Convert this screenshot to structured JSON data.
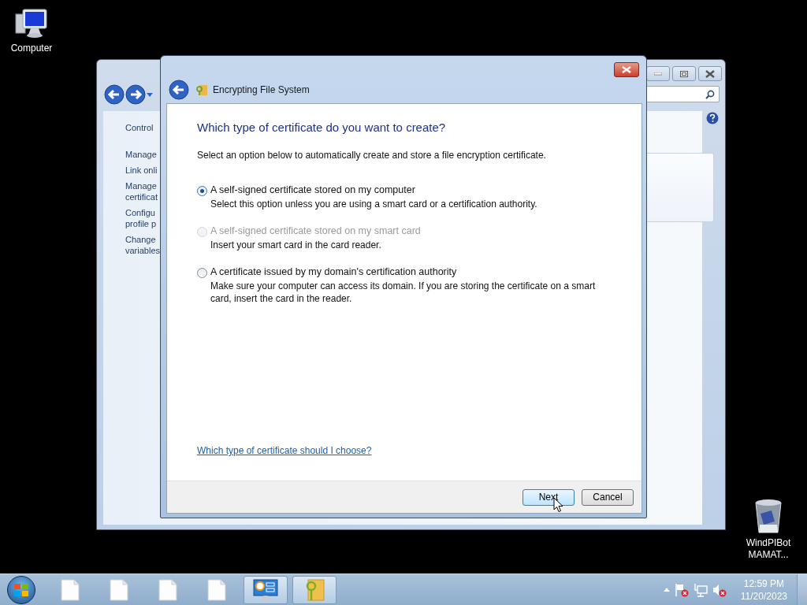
{
  "desktop_icons": [
    {
      "kind": "computer",
      "lines": [
        "Computer"
      ]
    },
    {
      "kind": "recycle-bin",
      "lines": [
        "WindPIBot",
        "MAMAT..."
      ]
    }
  ],
  "back_window": {
    "nav_items": [
      {
        "lines": [
          "Control"
        ]
      },
      {
        "lines": [
          "Manage"
        ]
      },
      {
        "lines": [
          "Link onli"
        ]
      },
      {
        "lines": [
          "Manage",
          "certificat"
        ]
      },
      {
        "lines": [
          "Configu",
          "profile p"
        ]
      },
      {
        "lines": [
          "Change",
          "variables"
        ]
      }
    ]
  },
  "dialog": {
    "title": "Encrypting File System",
    "heading": "Which type of certificate do you want to create?",
    "intro": "Select an option below to automatically create and store a file encryption certificate.",
    "options": [
      {
        "label": "A self-signed certificate stored on my computer",
        "description": "Select this option unless you are using a smart card or a certification authority.",
        "selected": true,
        "disabled": false
      },
      {
        "label": "A self-signed certificate stored on my smart card",
        "description": "Insert your smart card in the card reader.",
        "selected": false,
        "disabled": true
      },
      {
        "label": "A certificate issued by my domain's certification authority",
        "description": "Make sure your computer can access its domain. If you are storing the certificate on a smart card, insert the card in the reader.",
        "selected": false,
        "disabled": false
      }
    ],
    "help_link": "Which type of certificate should I choose?",
    "buttons": [
      {
        "label": "Next",
        "default": true
      },
      {
        "label": "Cancel",
        "default": false
      }
    ]
  },
  "taskbar": {
    "items": [
      {
        "kind": "document",
        "active": false
      },
      {
        "kind": "document",
        "active": false
      },
      {
        "kind": "document",
        "active": false
      },
      {
        "kind": "document",
        "active": false
      },
      {
        "kind": "control-panel",
        "active": true
      },
      {
        "kind": "folder-key",
        "active": true
      }
    ],
    "clock": {
      "time": "12:59 PM",
      "date": "11/20/2023"
    }
  }
}
